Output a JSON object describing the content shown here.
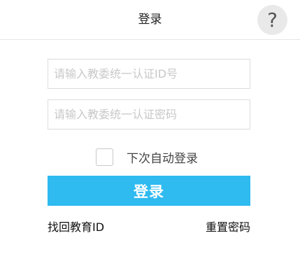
{
  "header": {
    "title": "登录",
    "help_icon": "question-mark-icon",
    "help_symbol": "?"
  },
  "form": {
    "id_placeholder": "请输入教委统一认证ID号",
    "password_placeholder": "请输入教委统一认证密码",
    "remember_label": "下次自动登录",
    "remember_checked": false,
    "login_label": "登录"
  },
  "links": {
    "find_id": "找回教育ID",
    "reset_password": "重置密码"
  },
  "colors": {
    "accent": "#2fbaf0",
    "help_background": "#e9e9e9",
    "divider": "#e6e6e6"
  }
}
